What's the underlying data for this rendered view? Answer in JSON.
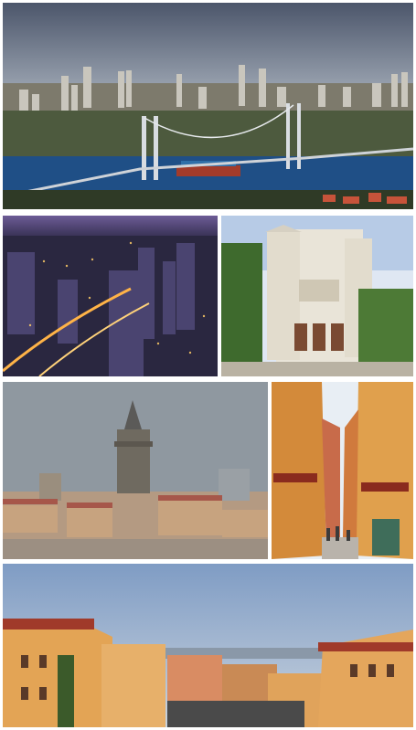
{
  "collage": {
    "tiles": [
      {
        "subject": "city-skyline-with-suspension-bridge-over-strait",
        "palette": {
          "sky": "#5f6b82",
          "water": "#1f4f86"
        }
      },
      {
        "subject": "city-at-night-aerial",
        "palette": {
          "sky": "#6a5a8c",
          "lights": "#ffcc66"
        }
      },
      {
        "subject": "white-stone-church-facade",
        "palette": {
          "sky": "#dfe7f3",
          "stone": "#e9e4d8"
        }
      },
      {
        "subject": "old-city-with-stone-tower",
        "palette": {
          "sky": "#8f98a0",
          "roofs": "#b88a6a"
        }
      },
      {
        "subject": "narrow-street-with-colorful-buildings",
        "palette": {
          "sky": "#e8eef4",
          "walls": "#d99a4a"
        }
      },
      {
        "subject": "terracotta-buildings-at-dusk",
        "palette": {
          "sky": "#9bb2cf",
          "walls": "#e3a455"
        }
      }
    ]
  }
}
